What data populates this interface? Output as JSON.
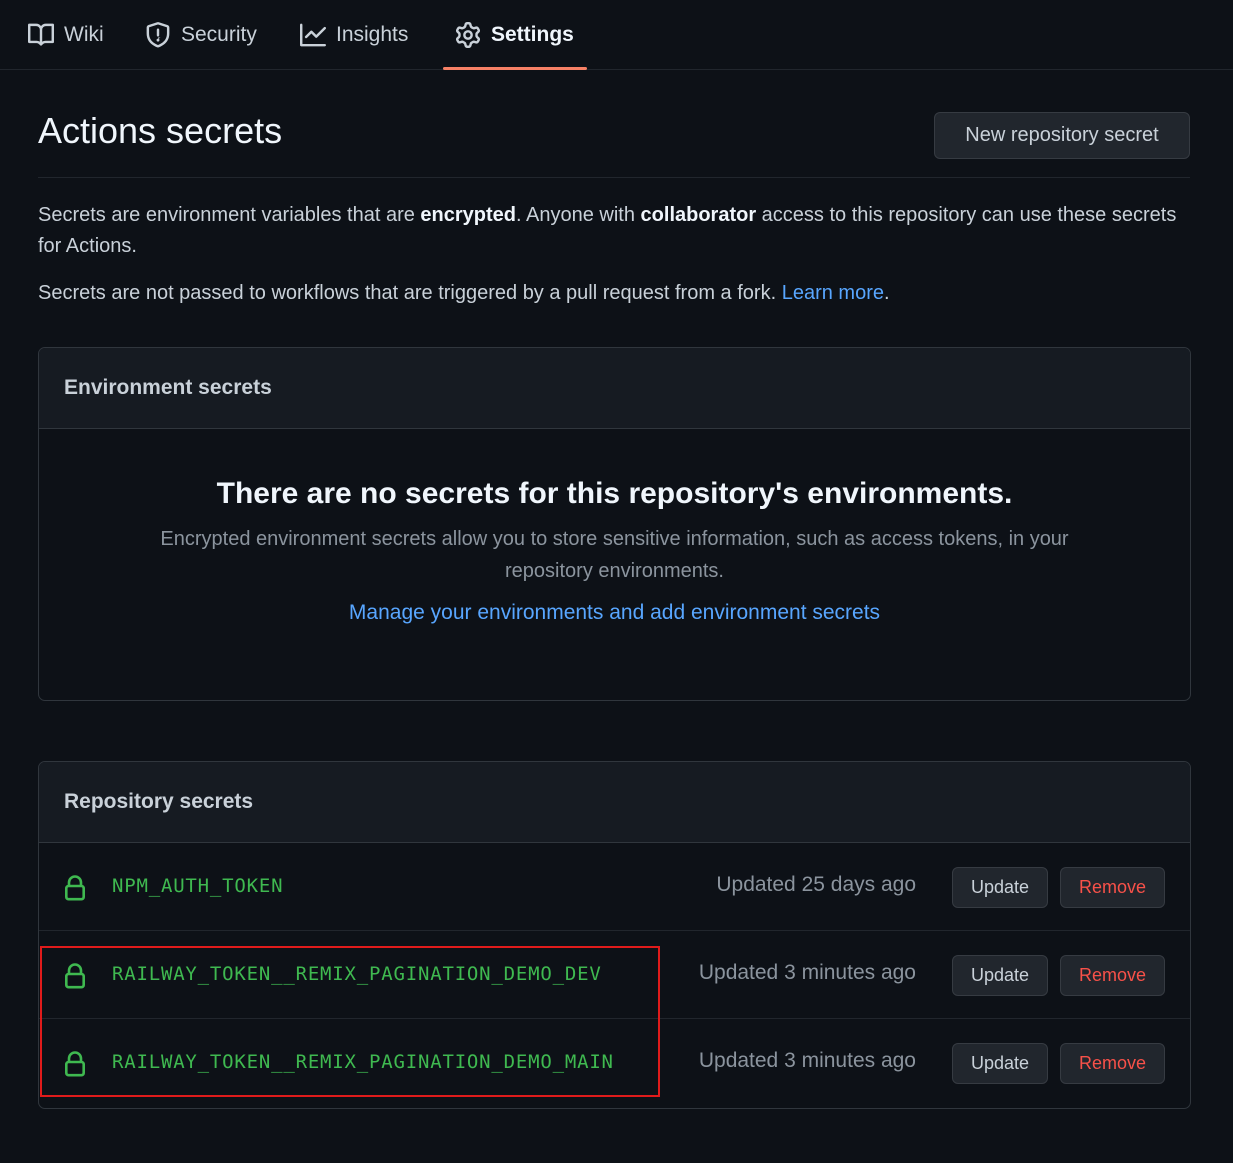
{
  "nav": {
    "tabs": [
      {
        "label": "Wiki",
        "icon": "book-icon"
      },
      {
        "label": "Security",
        "icon": "shield-icon"
      },
      {
        "label": "Insights",
        "icon": "graph-icon"
      },
      {
        "label": "Settings",
        "icon": "gear-icon",
        "active": true
      }
    ]
  },
  "page": {
    "title": "Actions secrets",
    "new_secret_button": "New repository secret",
    "desc1_a": "Secrets are environment variables that are ",
    "desc1_b": "encrypted",
    "desc1_c": ". Anyone with ",
    "desc1_d": "collaborator",
    "desc1_e": " access to this repository can use these secrets for Actions.",
    "desc2": "Secrets are not passed to workflows that are triggered by a pull request from a fork. ",
    "learn_more": "Learn more",
    "desc2_end": "."
  },
  "environment": {
    "heading": "Environment secrets",
    "empty_title": "There are no secrets for this repository's environments.",
    "empty_desc": "Encrypted environment secrets allow you to store sensitive information, such as access tokens, in your repository environments.",
    "manage_link": "Manage your environments and add environment secrets"
  },
  "repository": {
    "heading": "Repository secrets",
    "secrets": [
      {
        "name": "NPM_AUTH_TOKEN",
        "updated": "Updated 25 days ago",
        "update_label": "Update",
        "remove_label": "Remove"
      },
      {
        "name": "RAILWAY_TOKEN__REMIX_PAGINATION_DEMO_DEV",
        "updated": "Updated 3 minutes ago",
        "update_label": "Update",
        "remove_label": "Remove"
      },
      {
        "name": "RAILWAY_TOKEN__REMIX_PAGINATION_DEMO_MAIN",
        "updated": "Updated 3 minutes ago",
        "update_label": "Update",
        "remove_label": "Remove"
      }
    ]
  },
  "colors": {
    "background": "#0d1117",
    "accent_underline": "#f78166",
    "secret_name": "#3fb950",
    "remove_text": "#f85149",
    "link": "#58a6ff",
    "highlight_box": "#e01b1b"
  }
}
